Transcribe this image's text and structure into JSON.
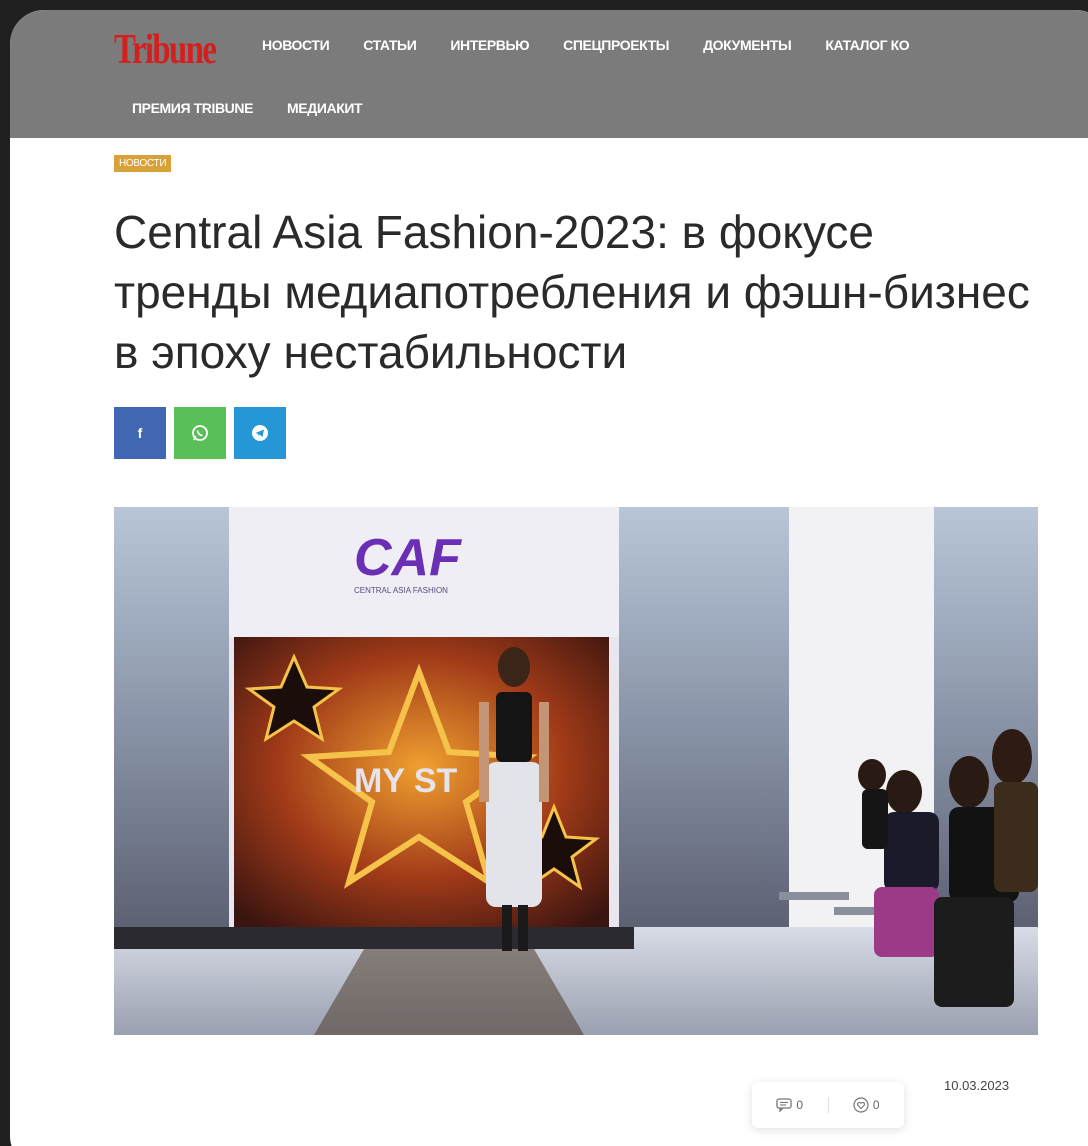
{
  "header": {
    "logo": "Tribune",
    "nav_row1": [
      "НОВОСТИ",
      "СТАТЬИ",
      "ИНТЕРВЬЮ",
      "СПЕЦПРОЕКТЫ",
      "ДОКУМЕНТЫ",
      "КАТАЛОГ КО"
    ],
    "nav_row2": [
      "ПРЕМИЯ TRIBUNE",
      "МЕДИАКИТ"
    ]
  },
  "article": {
    "category": "НОВОСТИ",
    "title": "Central Asia Fashion-2023: в фокусе тренды медиапотребления и фэшн-бизнес в эпоху нестабильности",
    "date": "10.03.2023",
    "hero_image": {
      "logo_text": "CAF",
      "logo_subtext": "CENTRAL ASIA FASHION",
      "backdrop_text": "MY ST"
    }
  },
  "share": {
    "facebook": "f",
    "icons": [
      "facebook-icon",
      "whatsapp-icon",
      "telegram-icon"
    ]
  },
  "stats": {
    "comments": "0",
    "likes": "0"
  },
  "colors": {
    "header_bg": "#7b7b7b",
    "logo_red": "#d41f1f",
    "badge": "#d9a13a",
    "facebook": "#4267b2",
    "whatsapp": "#5bbf57",
    "telegram": "#2596d6"
  }
}
